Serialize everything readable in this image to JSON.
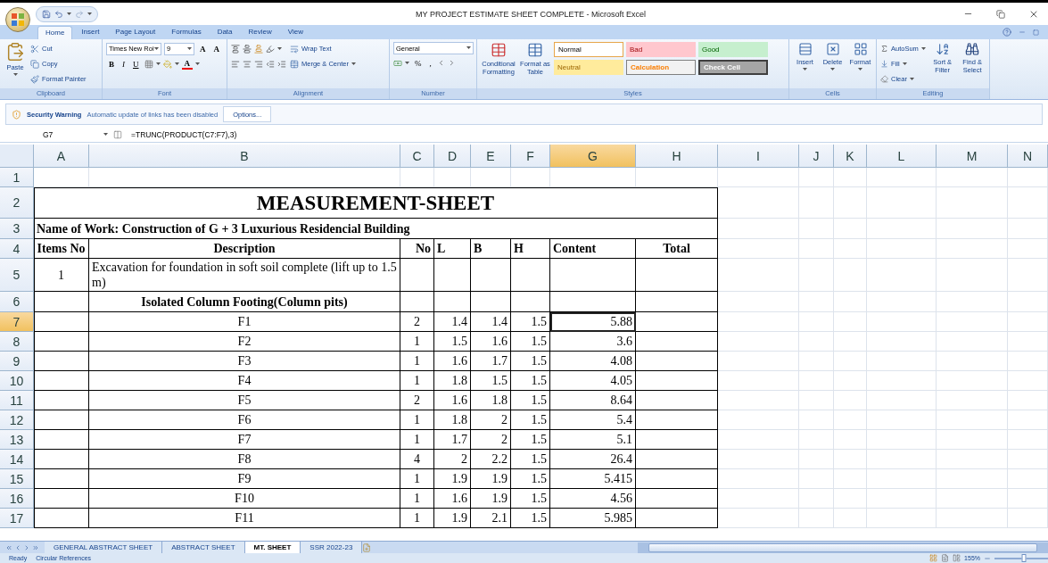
{
  "window": {
    "title": "MY PROJECT ESTIMATE SHEET COMPLETE - Microsoft Excel"
  },
  "ribbon": {
    "tabs": [
      {
        "label": "Home",
        "selected": true
      },
      {
        "label": "Insert",
        "selected": false
      },
      {
        "label": "Page Layout",
        "selected": false
      },
      {
        "label": "Formulas",
        "selected": false
      },
      {
        "label": "Data",
        "selected": false
      },
      {
        "label": "Review",
        "selected": false
      },
      {
        "label": "View",
        "selected": false
      }
    ],
    "clipboard": {
      "paste": "Paste",
      "items": [
        "Cut",
        "Copy",
        "Format Painter"
      ],
      "label": "Clipboard"
    },
    "font": {
      "name": "Times New Roi",
      "size": "9",
      "size_buttons": [
        "A",
        "A"
      ],
      "format_buttons": [
        "B",
        "I",
        "U"
      ],
      "font_color": "A",
      "label": "Font"
    },
    "alignment": {
      "wrap": "Wrap Text",
      "merge": "Merge & Center",
      "label": "Alignment"
    },
    "number": {
      "format": "General",
      "buttons": [
        "%",
        ","
      ],
      "label": "Number"
    },
    "styles": {
      "conditional": "Conditional Formatting",
      "format_table": "Format as Table",
      "tiles": [
        {
          "label": "Normal",
          "kind": "normal"
        },
        {
          "label": "Bad",
          "kind": "bad"
        },
        {
          "label": "Good",
          "kind": "good"
        },
        {
          "label": "Neutral",
          "kind": "neutral"
        },
        {
          "label": "Calculation",
          "kind": "calculation"
        },
        {
          "label": "Check Cell",
          "kind": "check"
        }
      ],
      "label": "Styles"
    },
    "cells": {
      "buttons": [
        "Insert",
        "Delete",
        "Format"
      ],
      "label": "Cells"
    },
    "editing": {
      "autosum": "AutoSum",
      "fill": "Fill",
      "clear": "Clear",
      "sort": "Sort & Filter",
      "find": "Find & Select",
      "label": "Editing"
    }
  },
  "security": {
    "title": "Security Warning",
    "message": "Automatic update of links has been disabled",
    "button": "Options..."
  },
  "formula_bar": {
    "name_box": "G7",
    "formula": "=TRUNC(PRODUCT(C7:F7),3)"
  },
  "sheet": {
    "columns": [
      {
        "label": "A",
        "selected": false
      },
      {
        "label": "B",
        "selected": false
      },
      {
        "label": "C",
        "selected": false
      },
      {
        "label": "D",
        "selected": false
      },
      {
        "label": "E",
        "selected": false
      },
      {
        "label": "F",
        "selected": false
      },
      {
        "label": "G",
        "selected": true
      },
      {
        "label": "H",
        "selected": false
      },
      {
        "label": "I",
        "selected": false
      },
      {
        "label": "J",
        "selected": false
      },
      {
        "label": "K",
        "selected": false
      },
      {
        "label": "L",
        "selected": false
      },
      {
        "label": "M",
        "selected": false
      },
      {
        "label": "N",
        "selected": false
      }
    ],
    "rows": [
      {
        "number": "1",
        "selected": false,
        "kind": "blank"
      },
      {
        "number": "2",
        "selected": false,
        "kind": "title",
        "text": "MEASUREMENT-SHEET"
      },
      {
        "number": "3",
        "selected": false,
        "kind": "work",
        "text": "Name of Work:  Construction of  G + 3 Luxurious Residencial Building"
      },
      {
        "number": "4",
        "selected": false,
        "kind": "header",
        "cells": [
          "Items No",
          "Description",
          "No",
          "L",
          "B",
          "H",
          "Content",
          "Total"
        ]
      },
      {
        "number": "5",
        "selected": false,
        "kind": "item",
        "item_no": "1",
        "description": "Excavation for foundation in soft soil  complete (lift up to 1.5 m)"
      },
      {
        "number": "6",
        "selected": false,
        "kind": "subhead",
        "text": "Isolated Column Footing(Column pits)"
      },
      {
        "number": "7",
        "selected": true,
        "kind": "entry",
        "name": "F1",
        "no": "2",
        "l": "1.4",
        "b": "1.4",
        "h": "1.5",
        "content": "5.88"
      },
      {
        "number": "8",
        "selected": false,
        "kind": "entry",
        "name": "F2",
        "no": "1",
        "l": "1.5",
        "b": "1.6",
        "h": "1.5",
        "content": "3.6"
      },
      {
        "number": "9",
        "selected": false,
        "kind": "entry",
        "name": "F3",
        "no": "1",
        "l": "1.6",
        "b": "1.7",
        "h": "1.5",
        "content": "4.08"
      },
      {
        "number": "10",
        "selected": false,
        "kind": "entry",
        "name": "F4",
        "no": "1",
        "l": "1.8",
        "b": "1.5",
        "h": "1.5",
        "content": "4.05"
      },
      {
        "number": "11",
        "selected": false,
        "kind": "entry",
        "name": "F5",
        "no": "2",
        "l": "1.6",
        "b": "1.8",
        "h": "1.5",
        "content": "8.64"
      },
      {
        "number": "12",
        "selected": false,
        "kind": "entry",
        "name": "F6",
        "no": "1",
        "l": "1.8",
        "b": "2",
        "h": "1.5",
        "content": "5.4"
      },
      {
        "number": "13",
        "selected": false,
        "kind": "entry",
        "name": "F7",
        "no": "1",
        "l": "1.7",
        "b": "2",
        "h": "1.5",
        "content": "5.1"
      },
      {
        "number": "14",
        "selected": false,
        "kind": "entry",
        "name": "F8",
        "no": "4",
        "l": "2",
        "b": "2.2",
        "h": "1.5",
        "content": "26.4"
      },
      {
        "number": "15",
        "selected": false,
        "kind": "entry",
        "name": "F9",
        "no": "1",
        "l": "1.9",
        "b": "1.9",
        "h": "1.5",
        "content": "5.415"
      },
      {
        "number": "16",
        "selected": false,
        "kind": "entry",
        "name": "F10",
        "no": "1",
        "l": "1.6",
        "b": "1.9",
        "h": "1.5",
        "content": "4.56"
      },
      {
        "number": "17",
        "selected": false,
        "kind": "entry",
        "name": "F11",
        "no": "1",
        "l": "1.9",
        "b": "2.1",
        "h": "1.5",
        "content": "5.985"
      }
    ]
  },
  "sheet_tabs": [
    {
      "label": "GENERAL ABSTRACT SHEET",
      "selected": false
    },
    {
      "label": "ABSTRACT SHEET",
      "selected": false
    },
    {
      "label": "MT. SHEET",
      "selected": true
    },
    {
      "label": "SSR 2022-23",
      "selected": false
    }
  ],
  "status_bar": {
    "items": [
      "Ready",
      "Circular References"
    ],
    "zoom": "155%",
    "zoom_level": {
      "level": 0.55
    }
  }
}
